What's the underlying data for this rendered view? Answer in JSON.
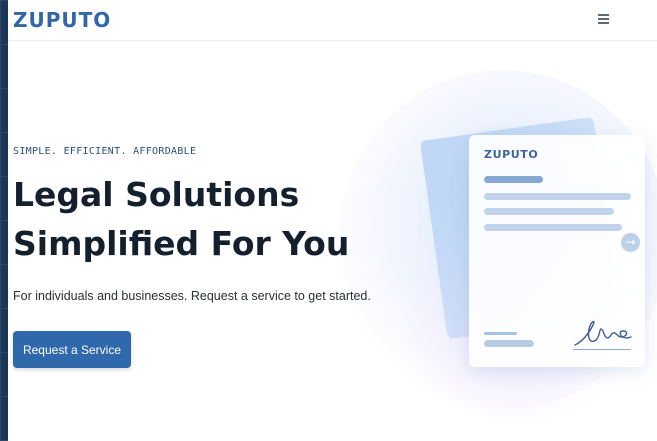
{
  "brand": "ZUPUTO",
  "header": {
    "menu_icon": "hamburger-menu-icon"
  },
  "hero": {
    "tagline": "SIMPLE. EFFICIENT. AFFORDABLE",
    "headline_line1": "Legal Solutions",
    "headline_line2": "Simplified For You",
    "subtitle": "For individuals and businesses. Request a service to get started.",
    "cta_label": "Request a Service"
  },
  "illustration": {
    "card_brand": "ZUPUTO",
    "arrow_icon": "arrow-right-icon",
    "signature_icon": "signature-icon"
  },
  "colors": {
    "brand": "#2f67a7",
    "cta_background": "#2f69ab",
    "headline": "#15202e",
    "frame": "#1c3655"
  }
}
